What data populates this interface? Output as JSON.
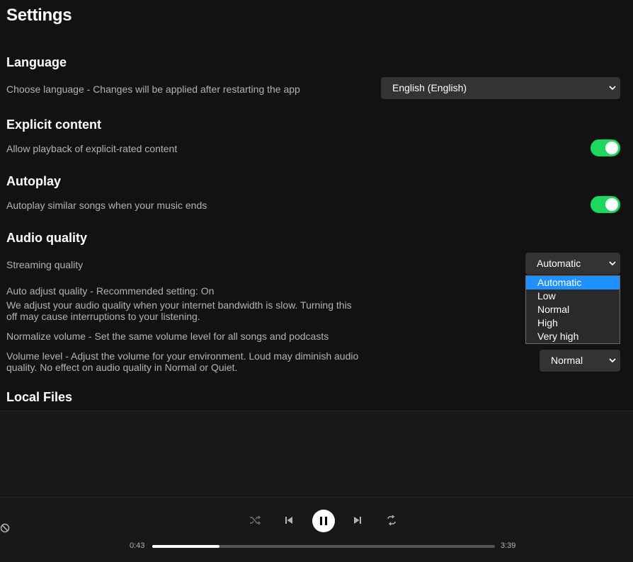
{
  "page": {
    "title": "Settings"
  },
  "language": {
    "heading": "Language",
    "description": "Choose language - Changes will be applied after restarting the app",
    "selected": "English (English)"
  },
  "explicit": {
    "heading": "Explicit content",
    "description": "Allow playback of explicit-rated content",
    "enabled": true
  },
  "autoplay": {
    "heading": "Autoplay",
    "description": "Autoplay similar songs when your music ends",
    "enabled": true
  },
  "audio_quality": {
    "heading": "Audio quality",
    "streaming_label": "Streaming quality",
    "streaming_selected": "Automatic",
    "streaming_options": [
      "Automatic",
      "Low",
      "Normal",
      "High",
      "Very high"
    ],
    "auto_adjust_title": "Auto adjust quality - Recommended setting: On",
    "auto_adjust_desc_line1": "We adjust your audio quality when your internet bandwidth is slow. Turning this",
    "auto_adjust_desc_line2": "off may cause interruptions to your listening.",
    "normalize_label": "Normalize volume - Set the same volume level for all songs and podcasts",
    "volume_level_line1": "Volume level - Adjust the volume for your environment. Loud may diminish audio",
    "volume_level_line2": "quality. No effect on audio quality in Normal or Quiet.",
    "volume_level_selected": "Normal"
  },
  "local_files": {
    "heading": "Local Files"
  },
  "player": {
    "elapsed": "0:43",
    "duration": "3:39",
    "progress_fraction": 0.196
  },
  "icons": {
    "chevron": "⌄",
    "shuffle": "⤮",
    "prev": "⏮",
    "next": "⏭",
    "repeat": "🔁",
    "blocked": "⊘"
  },
  "colors": {
    "accent": "#1ed760",
    "selection": "#1e90ff"
  }
}
